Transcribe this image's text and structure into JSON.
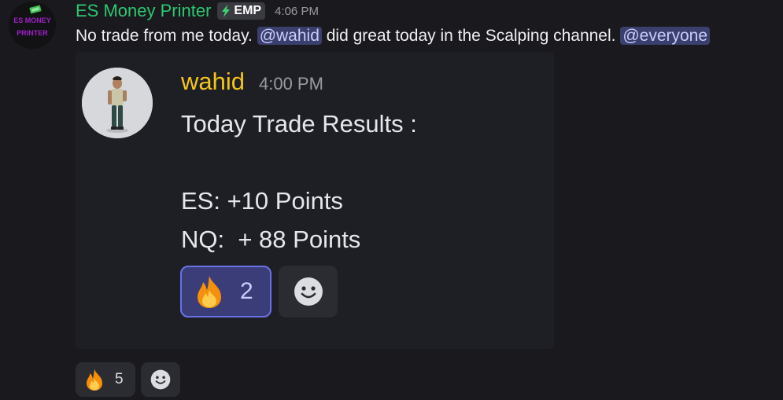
{
  "author": {
    "name": "ES Money Printer",
    "tag": "EMP",
    "time": "4:06 PM",
    "avatar_lines": [
      "ES MONEY",
      "PRINTER"
    ]
  },
  "message": {
    "text_1": "No trade from me today. ",
    "mention_1": "@wahid",
    "text_2": " did great today in the Scalping channel. ",
    "mention_2": "@everyone"
  },
  "embed": {
    "author": "wahid",
    "time": "4:00 PM",
    "lines": [
      "Today Trade Results :",
      "",
      "ES: +10 Points",
      "NQ:  + 88 Points"
    ],
    "reactions": [
      {
        "emoji": "fire-emoji",
        "count": "2",
        "active": true
      }
    ]
  },
  "reactions": [
    {
      "emoji": "fire-emoji",
      "count": "5",
      "active": false
    }
  ],
  "colors": {
    "username": "#2dc770",
    "embed_username": "#f5c518",
    "mention_bg": "#3b3f6e",
    "mention_text": "#c9cdfb",
    "background": "#1a1a1e"
  }
}
